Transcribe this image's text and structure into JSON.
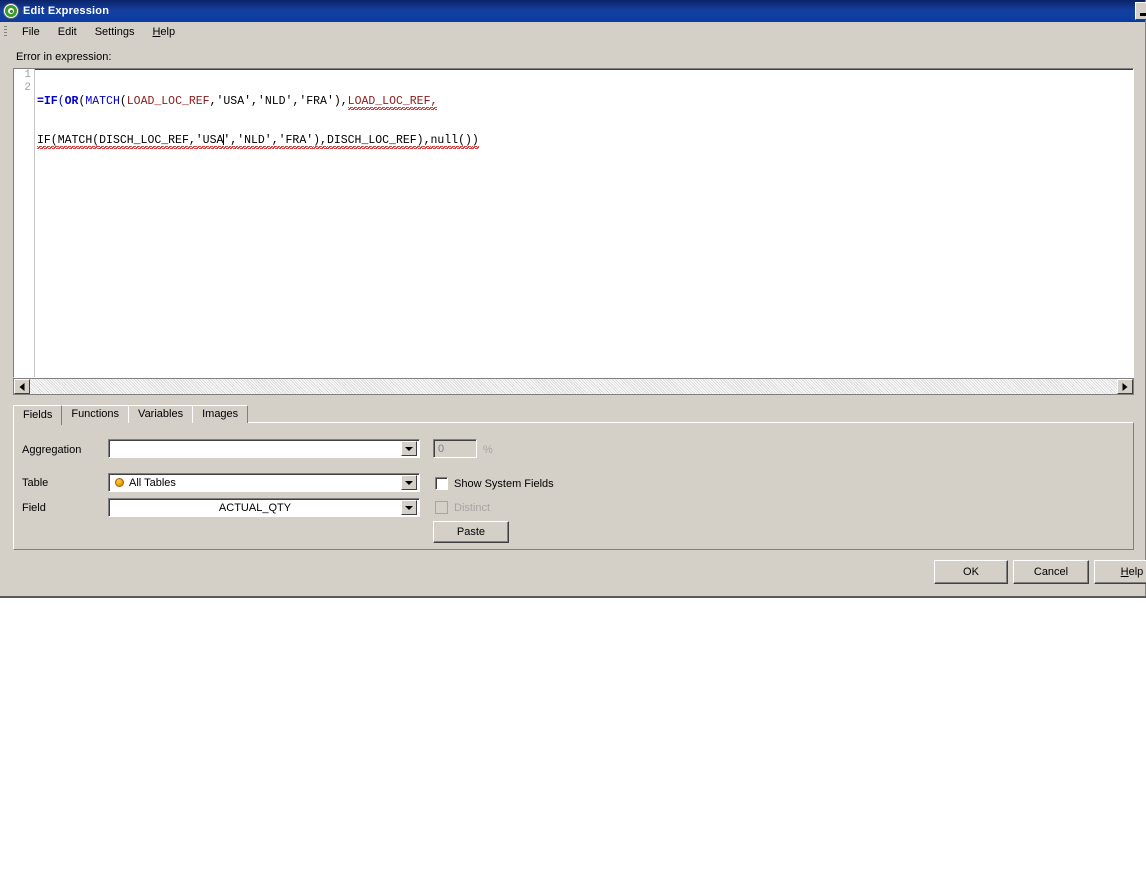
{
  "window": {
    "title": "Edit Expression",
    "icon": "qlikview-target-icon",
    "restore_button": "restore-window"
  },
  "menubar": {
    "items": [
      {
        "label": "File"
      },
      {
        "label": "Edit"
      },
      {
        "label": "Settings"
      },
      {
        "label": "Help",
        "accel": "H"
      }
    ]
  },
  "editor": {
    "error_label": "Error in expression:",
    "line_numbers": [
      "1",
      "2"
    ],
    "expression_lines": [
      "=IF(OR(MATCH(LOAD_LOC_REF,'USA','NLD','FRA'),LOAD_LOC_REF,",
      "IF(MATCH(DISCH_LOC_REF,'USA','NLD','FRA'),DISCH_LOC_REF),null())"
    ],
    "line1": {
      "eq": "=",
      "if": "IF",
      "p1": "(",
      "or": "OR",
      "p2": "(",
      "match": "MATCH",
      "p3": "(",
      "field1": "LOAD_LOC_REF",
      "comma1": ",",
      "s_usa": "'USA'",
      "comma2": ",",
      "s_nld": "'NLD'",
      "comma3": ",",
      "s_fra": "'FRA'",
      "p4": ")",
      "comma4": ",",
      "field2": "LOAD_LOC_REF,"
    },
    "line2": {
      "if": "IF(",
      "match": "MATCH(",
      "field1": "DISCH_LOC_REF,",
      "s_usa_pre": "'USA",
      "s_usa_post": "'",
      "comma1": ",",
      "s_nld": "'NLD'",
      "comma2": ",",
      "s_fra": "'FRA'",
      "p1": "),",
      "field2": "DISCH_LOC_REF)",
      "comma3": ",",
      "nullfn": "null()",
      "p2": ")"
    },
    "scrollbar": {
      "left_arrow": "scroll-left",
      "right_arrow": "scroll-right"
    }
  },
  "tabs": [
    {
      "label": "Fields",
      "active": true
    },
    {
      "label": "Functions",
      "active": false
    },
    {
      "label": "Variables",
      "active": false
    },
    {
      "label": "Images",
      "active": false
    }
  ],
  "fields_panel": {
    "aggregation": {
      "label": "Aggregation",
      "value": "",
      "percent_value": "0",
      "percent_symbol": "%"
    },
    "table": {
      "label": "Table",
      "value": "All Tables",
      "icon": "orange-dot-icon"
    },
    "field": {
      "label": "Field",
      "value": "ACTUAL_QTY"
    },
    "show_system_fields": {
      "label": "Show System Fields",
      "checked": false,
      "enabled": true
    },
    "distinct": {
      "label": "Distinct",
      "checked": false,
      "enabled": false
    },
    "paste_button": "Paste"
  },
  "footer": {
    "ok": "OK",
    "cancel": "Cancel",
    "help": "Help",
    "help_accel": "H"
  },
  "colors": {
    "titlebar": "#0a3ba0",
    "dialog_face": "#d4d0c8",
    "keyword": "#0000d0",
    "field": "#8b1a1a",
    "error_squiggle": "#d00000",
    "table_dot": "#f0a000"
  }
}
